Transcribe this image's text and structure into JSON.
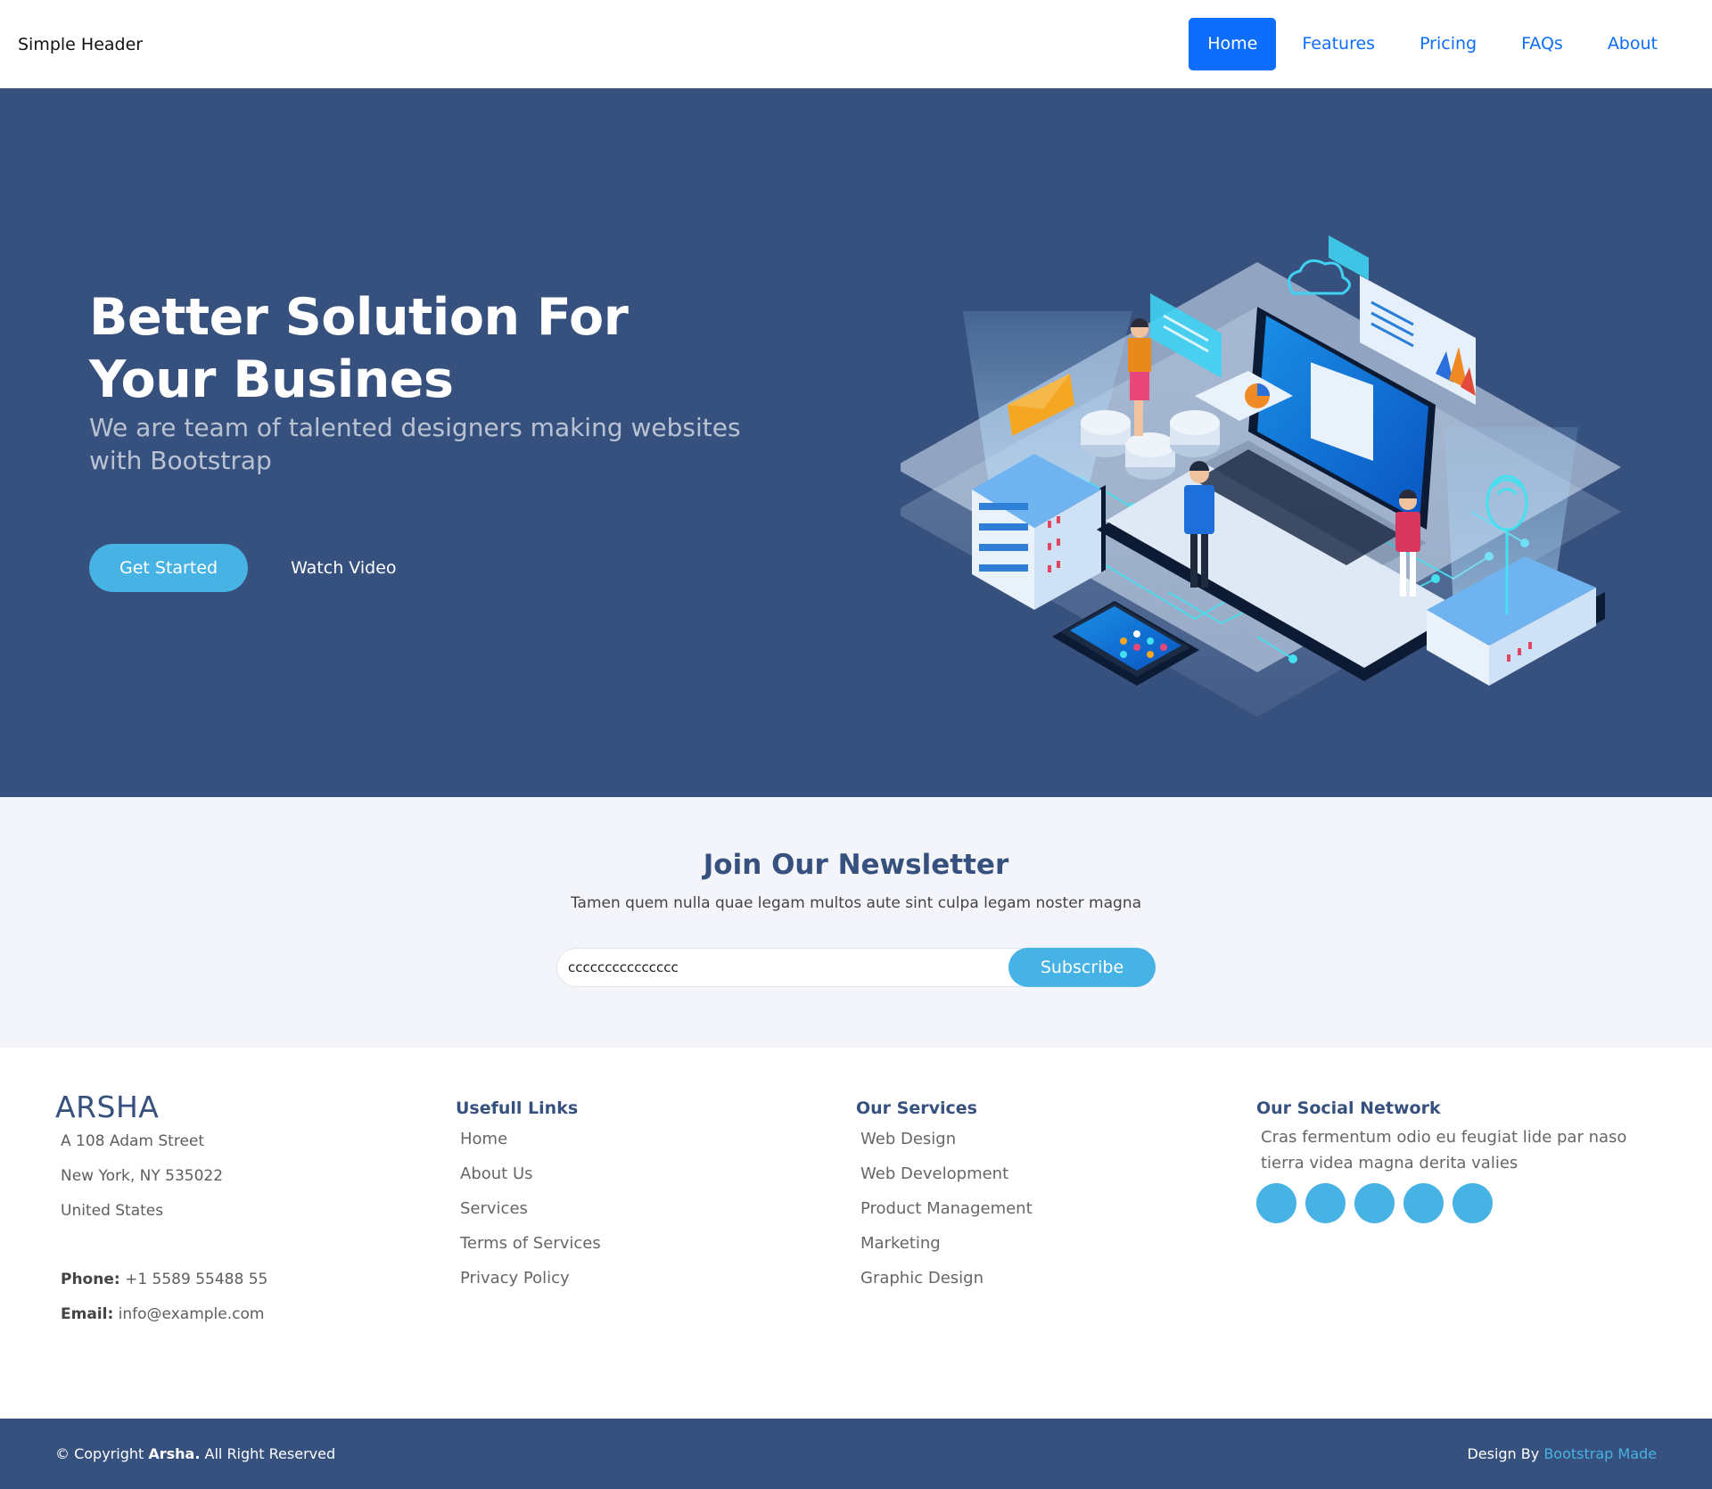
{
  "header": {
    "brand": "Simple Header",
    "nav": [
      {
        "label": "Home",
        "active": true
      },
      {
        "label": "Features",
        "active": false
      },
      {
        "label": "Pricing",
        "active": false
      },
      {
        "label": "FAQs",
        "active": false
      },
      {
        "label": "About",
        "active": false
      }
    ]
  },
  "hero": {
    "title": "Better Solution For Your Busines",
    "subtitle": "We are team of talented designers making websites with Bootstrap",
    "primary_button": "Get Started",
    "secondary_button": "Watch Video"
  },
  "newsletter": {
    "title": "Join Our Newsletter",
    "description": "Tamen quem nulla quae legam multos aute sint culpa legam noster magna",
    "input_value": "ccccccccccccccc",
    "button": "Subscribe"
  },
  "footer": {
    "logo": "ARSHA",
    "address": [
      "A 108 Adam Street",
      "New York, NY 535022",
      "United States"
    ],
    "phone_label": "Phone:",
    "phone": "+1 5589 55488 55",
    "email_label": "Email:",
    "email": "info@example.com",
    "links": {
      "title": "Usefull Links",
      "items": [
        "Home",
        "About Us",
        "Services",
        "Terms of Services",
        "Privacy Policy"
      ]
    },
    "services": {
      "title": "Our Services",
      "items": [
        "Web Design",
        "Web Development",
        "Product Management",
        "Marketing",
        "Graphic Design"
      ]
    },
    "social": {
      "title": "Our Social Network",
      "text": "Cras fermentum odio eu feugiat lide par naso tierra videa magna derita valies",
      "icons": [
        "social-icon-1",
        "social-icon-2",
        "social-icon-3",
        "social-icon-4",
        "social-icon-5"
      ]
    },
    "bottom": {
      "copyright_prefix": "© Copyright",
      "copyright_brand": "Arsha.",
      "copyright_suffix": "All Right Reserved",
      "credit_prefix": "Design By",
      "credit_link": "Bootstrap Made"
    }
  },
  "colors": {
    "primary_dark": "#37517e",
    "accent": "#47b2e4",
    "nav_blue": "#0d6efd",
    "newsletter_bg": "#f3f5fa"
  }
}
